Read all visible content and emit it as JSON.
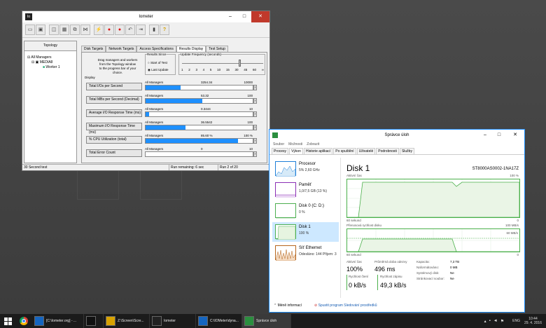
{
  "iometer": {
    "title": "Iometer",
    "icon_text": "Io",
    "toolbar_icons": [
      "open-icon",
      "save-icon",
      "new-worker-icon",
      "new-manager-icon",
      "copy-worker-icon",
      "disconnect-icon",
      "start-icon",
      "stop-icon",
      "stop-all-icon",
      "reset-icon",
      "exit-icon",
      "book-icon",
      "help-icon"
    ],
    "topology": {
      "label": "Topology",
      "root": "All Managers",
      "manager": "MEDIA8",
      "worker": "Worker 1"
    },
    "tabs": [
      "Disk Targets",
      "Network Targets",
      "Access Specifications",
      "Results Display",
      "Test Setup"
    ],
    "drag_text": [
      "Drag managers and workers",
      "from the Topology window",
      "to the progress bar of your choice."
    ],
    "results_since": {
      "label": "Results Since",
      "opt1": "Start of Test",
      "opt2": "Last Update"
    },
    "update_freq": {
      "label": "Update Frequency (seconds)",
      "ticks": [
        "1",
        "2",
        "3",
        "4",
        "5",
        "10",
        "15",
        "30",
        "45",
        "60",
        "∞"
      ]
    },
    "display_label": "Display",
    "metrics": [
      {
        "button": "Total I/Os per Second",
        "source": "All Managers",
        "value": "3254.34",
        "max": "10000",
        "frac": 0.33
      },
      {
        "button": "Total MBs per Second (Decimal)",
        "source": "All Managers",
        "value": "53.32",
        "max": "100",
        "frac": 0.53
      },
      {
        "button": "Average I/O Response Time (ms)",
        "source": "All Managers",
        "value": "0.3444",
        "max": "10",
        "frac": 0.03
      },
      {
        "button": "Maximum I/O Response Time (ms)",
        "source": "All Managers",
        "value": "36.5542",
        "max": "100",
        "frac": 0.37
      },
      {
        "button": "% CPU Utilization (total)",
        "source": "All Managers",
        "value": "85.60 %",
        "max": "100 %",
        "frac": 0.86
      },
      {
        "button": "Total Error Count",
        "source": "All Managers",
        "value": "0",
        "max": "10",
        "frac": 0
      }
    ],
    "status": [
      "30 Second test",
      "Run remaining: 6 sec",
      "Run 2 of 20"
    ]
  },
  "taskmgr": {
    "title": "Správce úloh",
    "menu": [
      "Soubor",
      "Možnosti",
      "Zobrazit"
    ],
    "tabs": [
      "Procesy",
      "Výkon",
      "Historie aplikací",
      "Po spuštění",
      "Uživatelé",
      "Podrobnosti",
      "Služby"
    ],
    "sidebar": [
      {
        "name": "Procesor",
        "sub": "5% 2,60 GHz",
        "color": "#1e7fd8"
      },
      {
        "name": "Paměť",
        "sub": "1,0/7,5 GB (13 %)",
        "color": "#8b2fb5"
      },
      {
        "name": "Disk 0 (C: D:)",
        "sub": "0 %",
        "color": "#4caf50"
      },
      {
        "name": "Disk 1",
        "sub": "100 %",
        "color": "#4caf50"
      },
      {
        "name": "Síť Ethernet",
        "sub": "Odesláno: 144 Přijem: 3",
        "color": "#b5651d"
      }
    ],
    "disk_title": "Disk 1",
    "disk_model": "ST8000AS0002-1NA17Z",
    "g1": {
      "left": "Aktivní čas",
      "right": "100 %",
      "bl": "60 sekund",
      "br": "0"
    },
    "g2": {
      "left": "Přenosová rychlost disku",
      "right": "100 MB/s",
      "inner": "60 MB/s",
      "bl": "60 sekund",
      "br": "0"
    },
    "active_time": {
      "label": "Aktivní čas",
      "value": "100%"
    },
    "avg_resp": {
      "label": "Průměrná doba odezvy",
      "value": "496 ms"
    },
    "read": {
      "label": "Rychlost čtení",
      "value": "0 kB/s"
    },
    "write": {
      "label": "Rychlost zápisu",
      "value": "49,3 kB/s"
    },
    "props": [
      [
        "Kapacita:",
        "7,3 TB"
      ],
      [
        "Naformátováno:",
        "0 MB"
      ],
      [
        "Systémový disk:",
        "Ne"
      ],
      [
        "Stránkovací soubor:",
        "Ne"
      ]
    ],
    "less": "Méně informací",
    "open_res": "Spustit program Sledování prostředků"
  },
  "taskbar": {
    "items": [
      "[C:\\Iometer.org] - ...",
      "",
      "Z:\\Screen\\Scre...",
      "Iometer",
      "C:\\IOMeter\\dyna...",
      "Správce úloh"
    ],
    "lang": "ENG",
    "time": "10:44",
    "date": "29. 4. 2016"
  }
}
